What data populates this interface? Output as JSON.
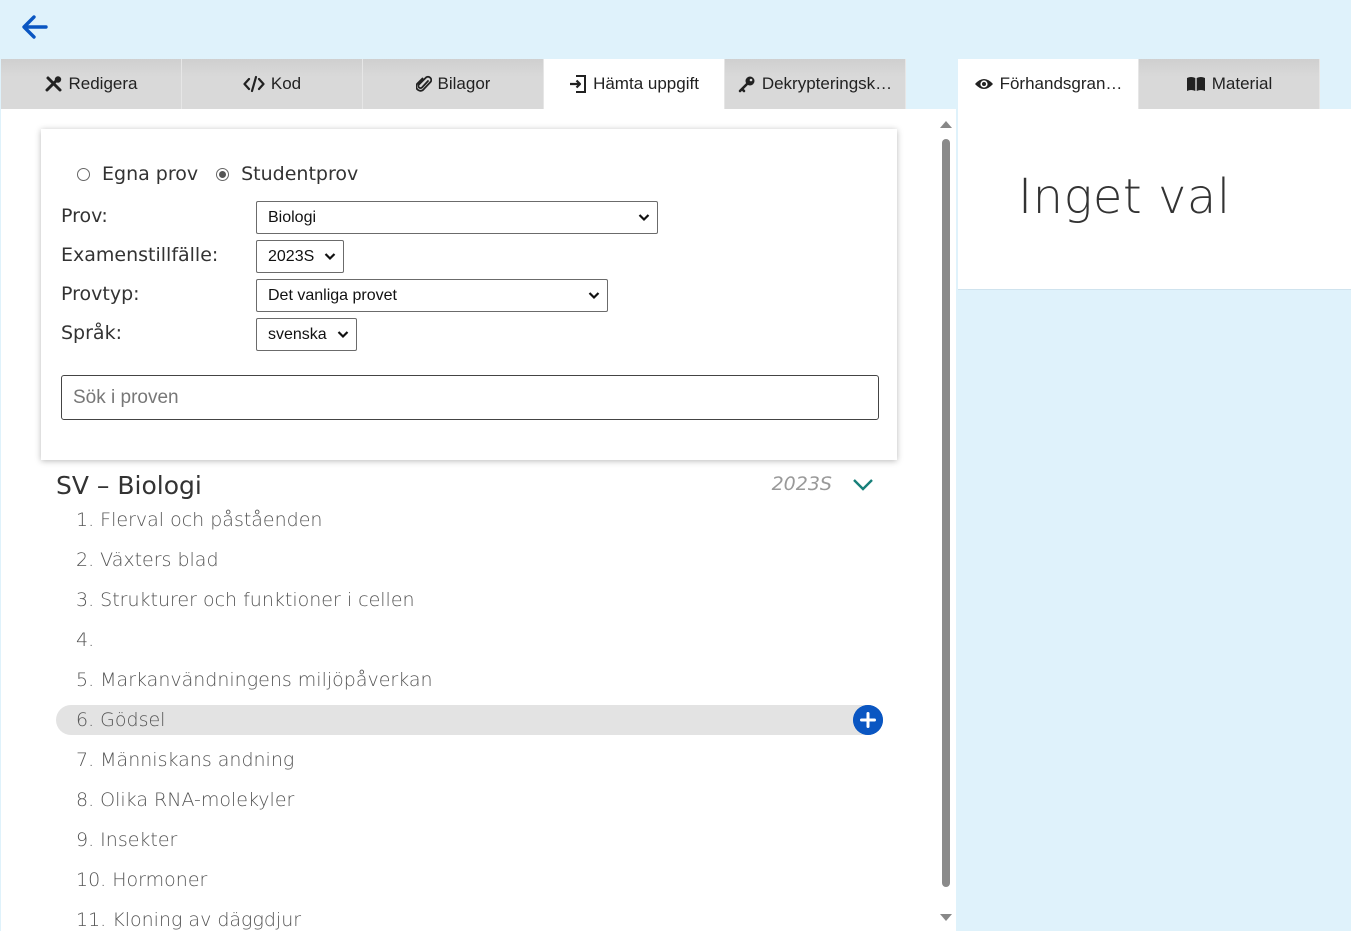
{
  "nav": {
    "back_icon": "arrow-left-icon",
    "accent": "#0a56c2"
  },
  "tabs_left": [
    {
      "label": "Redigera",
      "icon": "tools-icon"
    },
    {
      "label": "Kod",
      "icon": "code-icon"
    },
    {
      "label": "Bilagor",
      "icon": "paperclip-icon"
    },
    {
      "label": "Hämta uppgift",
      "icon": "import-icon",
      "active": true
    },
    {
      "label": "Dekrypteringsk…",
      "icon": "key-icon"
    }
  ],
  "tabs_right": [
    {
      "label": "Förhandsgran…",
      "icon": "eye-icon",
      "active": true
    },
    {
      "label": "Material",
      "icon": "book-icon"
    }
  ],
  "source": {
    "options": [
      {
        "label": "Egna prov",
        "checked": false
      },
      {
        "label": "Studentprov",
        "checked": true
      }
    ]
  },
  "filters": {
    "prov": {
      "label": "Prov:",
      "value": "Biologi"
    },
    "exam": {
      "label": "Examenstillfälle:",
      "value": "2023S"
    },
    "provtyp": {
      "label": "Provtyp:",
      "value": "Det vanliga provet"
    },
    "sprak": {
      "label": "Språk:",
      "value": "svenska"
    }
  },
  "search": {
    "placeholder": "Sök i proven",
    "value": ""
  },
  "exam_section": {
    "title": "SV – Biologi",
    "year": "2023S",
    "questions": [
      {
        "label": "1. Flerval och påståenden"
      },
      {
        "label": "2. Växters blad"
      },
      {
        "label": "3. Strukturer och funktioner i cellen"
      },
      {
        "label": "4."
      },
      {
        "label": "5. Markanvändningens miljöpåverkan"
      },
      {
        "label": "6. Gödsel",
        "highlighted": true
      },
      {
        "label": "7. Människans andning"
      },
      {
        "label": "8. Olika RNA-molekyler"
      },
      {
        "label": "9. Insekter"
      },
      {
        "label": "10. Hormoner"
      },
      {
        "label": "11. Kloning av däggdjur"
      }
    ]
  },
  "preview": {
    "text": "Inget val"
  },
  "colors": {
    "background": "#dff2fb",
    "tab_inactive": "#d9d9d9",
    "add_button": "#0a56c2",
    "chevron": "#17807a"
  }
}
